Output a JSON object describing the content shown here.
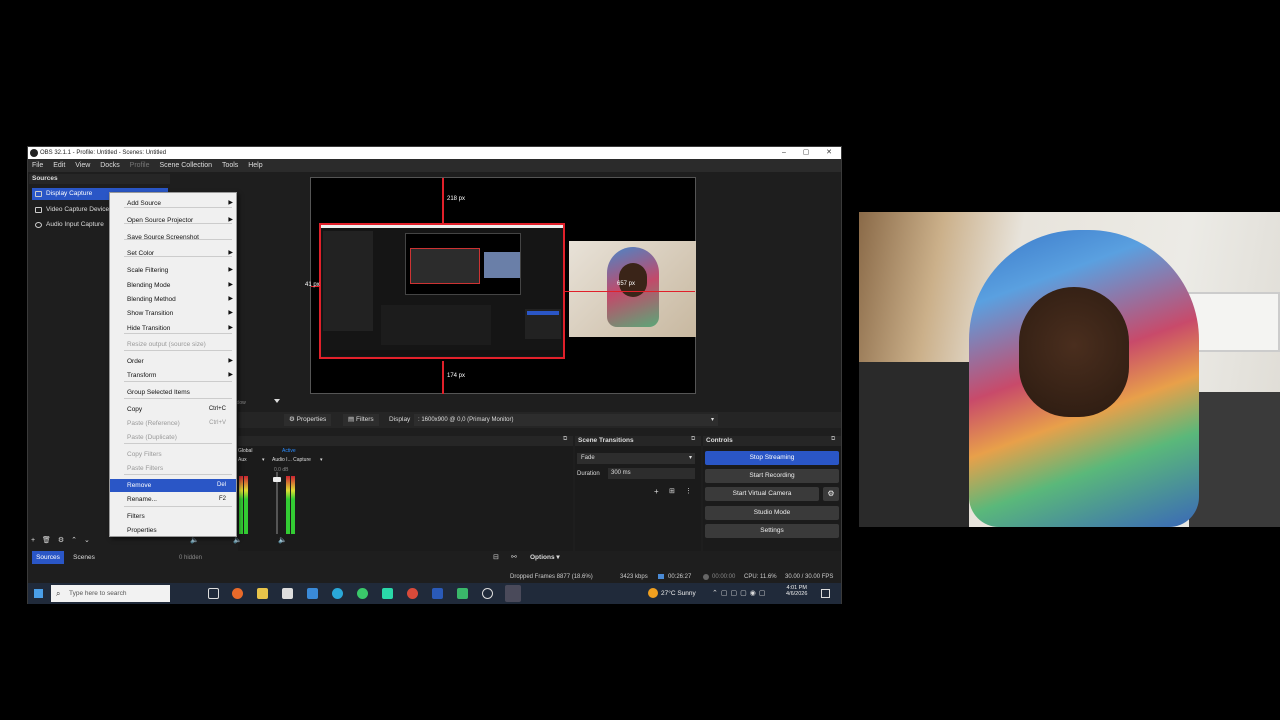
{
  "window": {
    "title": "OBS 32.1.1 - Profile: Untitled - Scenes: Untitled",
    "controls": [
      "–",
      "▢",
      "✕"
    ]
  },
  "menubar": [
    "File",
    "Edit",
    "View",
    "Docks",
    "Profile",
    "Scene Collection",
    "Tools",
    "Help"
  ],
  "sources": {
    "header": "Sources",
    "items": [
      "Display Capture",
      "Video Capture Device",
      "Audio Input Capture"
    ],
    "selected_index": 0
  },
  "preview": {
    "guides": {
      "top": "218 px",
      "left": "41 px",
      "right": "657 px",
      "bottom": "174 px"
    }
  },
  "context_menu": {
    "items": [
      {
        "label": "Add Source",
        "submenu": true
      },
      {
        "label": "Open Source Projector",
        "submenu": true
      },
      {
        "label": "Save Source Screenshot"
      },
      {
        "label": "Set Color",
        "submenu": true
      },
      {
        "label": "Scale Filtering",
        "submenu": true
      },
      {
        "label": "Blending Mode",
        "submenu": true
      },
      {
        "label": "Blending Method",
        "submenu": true
      },
      {
        "label": "Show Transition",
        "submenu": true
      },
      {
        "label": "Hide Transition",
        "submenu": true
      },
      {
        "label": "Resize output (source size)",
        "disabled": true
      },
      {
        "label": "Order",
        "submenu": true
      },
      {
        "label": "Transform",
        "submenu": true
      },
      {
        "label": "Group Selected Items"
      },
      {
        "label": "Copy",
        "shortcut": "Ctrl+C"
      },
      {
        "label": "Paste (Reference)",
        "shortcut": "Ctrl+V",
        "disabled": true
      },
      {
        "label": "Paste (Duplicate)",
        "disabled": true
      },
      {
        "label": "Copy Filters",
        "disabled": true
      },
      {
        "label": "Paste Filters",
        "disabled": true
      },
      {
        "label": "Remove",
        "shortcut": "Del",
        "highlighted": true
      },
      {
        "label": "Rename...",
        "shortcut": "F2"
      },
      {
        "label": "Filters"
      },
      {
        "label": "Properties"
      }
    ]
  },
  "source_toolbar": {
    "properties": "Properties",
    "filters": "Filters",
    "display_label": "Display",
    "display_value": ": 1600x900 @ 0,0 (Primary Monitor)",
    "window_tab": "Window"
  },
  "audio_mixer": {
    "tabs": [
      "Global",
      "Active"
    ],
    "channels": [
      "Aux",
      "Audio I... Capture"
    ],
    "db": "0.0 dB"
  },
  "scene_transitions": {
    "header": "Scene Transitions",
    "transition": "Fade",
    "duration_label": "Duration",
    "duration_value": "300 ms"
  },
  "controls": {
    "header": "Controls",
    "buttons": [
      "Stop Streaming",
      "Start Recording",
      "Start Virtual Camera",
      "Studio Mode",
      "Settings"
    ]
  },
  "bottom_tabs": {
    "sources": "Sources",
    "scenes": "Scenes"
  },
  "bottom_info": {
    "hidden": "0 hidden",
    "options": "Options"
  },
  "status": {
    "dropped": "Dropped Frames 8877 (18.6%)",
    "bitrate": "3423 kbps",
    "stream_time": "00:26:27",
    "rec_time": "00:00:00",
    "cpu": "CPU: 11.6%",
    "fps": "30.00 / 30.00 FPS"
  },
  "taskbar": {
    "search_placeholder": "Type here to search",
    "weather": "27°C  Sunny",
    "time": "4:01 PM",
    "date": "4/6/2026"
  },
  "colors": {
    "accent": "#2a56c6",
    "panel": "#1e1e1e",
    "menu_bg": "#f0f0f0",
    "guide_red": "#e0202a"
  }
}
